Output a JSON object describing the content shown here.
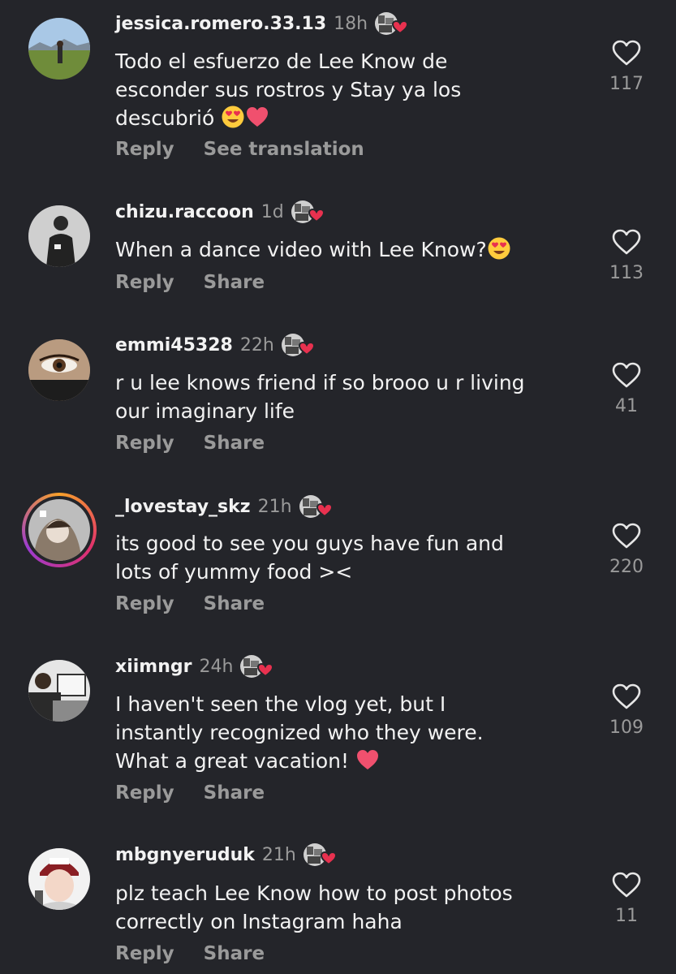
{
  "comments": [
    {
      "username": "jessica.romero.33.13",
      "time": "18h",
      "lines": [
        "Todo el esfuerzo de Lee Know de",
        "esconder sus rostros y Stay ya los",
        "descubrió"
      ],
      "actions": [
        "Reply",
        "See translation"
      ],
      "likes": "117"
    },
    {
      "username": "chizu.raccoon",
      "time": "1d",
      "lines": [
        "When a dance video with Lee Know?"
      ],
      "actions": [
        "Reply",
        "Share"
      ],
      "likes": "113"
    },
    {
      "username": "emmi45328",
      "time": "22h",
      "lines": [
        "r u lee knows friend if so brooo u r living",
        "our imaginary life"
      ],
      "actions": [
        "Reply",
        "Share"
      ],
      "likes": "41"
    },
    {
      "username": "_lovestay_skz",
      "time": "21h",
      "lines": [
        "its good to see you guys have fun and",
        "lots of yummy food ><"
      ],
      "actions": [
        "Reply",
        "Share"
      ],
      "likes": "220"
    },
    {
      "username": "xiimngr",
      "time": "24h",
      "lines": [
        "I haven't seen the vlog yet, but I",
        "instantly recognized who they were.",
        "What a great vacation!"
      ],
      "actions": [
        "Reply",
        "Share"
      ],
      "likes": "109"
    },
    {
      "username": "mbgnyeruduk",
      "time": "21h",
      "lines": [
        "plz teach Lee Know how to post photos",
        "correctly on Instagram haha"
      ],
      "actions": [
        "Reply",
        "Share"
      ],
      "likes": "11"
    }
  ],
  "icons": {
    "like": "heart-outline-icon",
    "badge": "creator-liked-heart-icon"
  },
  "colors": {
    "background": "#24252a",
    "text": "#f2f2f2",
    "muted": "#9a9a9a",
    "heart": "#e8314f"
  }
}
